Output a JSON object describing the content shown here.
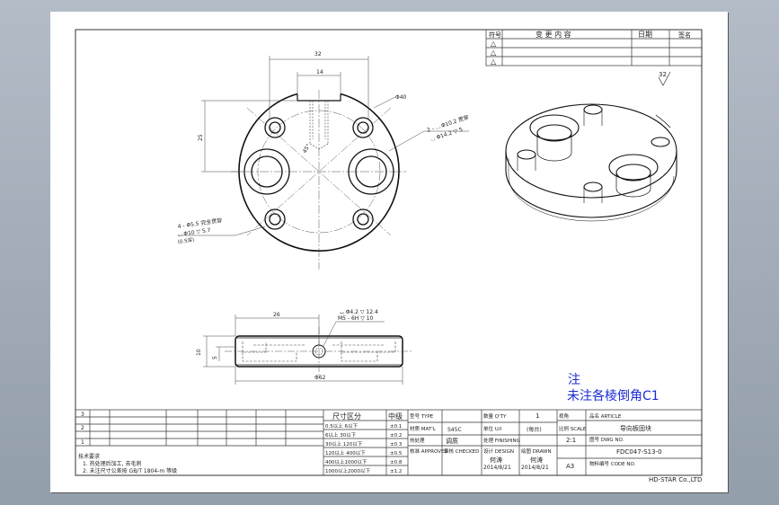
{
  "revision_table": {
    "headers": [
      "符号",
      "变 更 内 容",
      "日期",
      "签名"
    ],
    "rows": [
      "△",
      "△",
      "△"
    ]
  },
  "surface_symbol": "32",
  "dims": {
    "top_width": "32",
    "slot_width": "14",
    "outer_dia": "Φ40",
    "height_left": "25",
    "angle": "45°",
    "counterbore": [
      "2 - ⌴ Φ10.2 贯穿",
      "⌴ Φ14.2 ▽ 5"
    ],
    "small_holes": [
      "4 - Φ5.5 完全贯穿",
      "⌴ Φ10 ▽ 5.7",
      "(0.5深)"
    ],
    "thread": [
      "⌴ Φ4.2 ▽ 12.4",
      "M5 - 6H ▽ 10"
    ],
    "side_len": "26",
    "side_height": "10",
    "side_inner": "5",
    "side_dia": "Φ62"
  },
  "note": {
    "title": "注",
    "body": "未注各棱倒角C1"
  },
  "title_block": {
    "left_rows": [
      "3",
      "2",
      "1"
    ],
    "tech_title": "技术要求",
    "tech_lines": [
      "1. 热处理后加工, 去毛刺",
      "2. 未注尺寸公差按 GB/T 1804-m 等级"
    ],
    "size_header": "尺寸区分",
    "tol_header": "中级",
    "sizes": [
      "0.5以上 6以下",
      "6以上 30以下",
      "30以上 120以下",
      "120以上 400以下",
      "400以上1000以下",
      "1000以上2000以下"
    ],
    "tols": [
      "±0.1",
      "±0.2",
      "±0.3",
      "±0.5",
      "±0.8",
      "±1.2"
    ],
    "type_label": "型号 TYPE",
    "mat_label": "材质 MAT'L",
    "mat_value": "S45C",
    "heat_label": "热处理",
    "heat_value": "调质",
    "qty_label": "数量 Q'TY",
    "qty_value": "1",
    "unit_label": "单位 U/I",
    "unit_value": "(每台)",
    "finish_label": "处理 FINISHING",
    "approved_label": "核准 APPROVED",
    "checked_label": "审核 CHECKED",
    "design_label": "设计 DESIGN",
    "drawn_label": "绘图 DRAWN",
    "drafter": "何涛",
    "designer": "何涛",
    "date1": "2014/8/21",
    "date2": "2014/8/21",
    "proj_label": "视角",
    "scale_label": "比例 SCALE",
    "scale_value": "2:1",
    "size_value": "A3",
    "name_label": "品名 ARTICLE",
    "name_value": "导向板固块",
    "dwg_label": "图号 DWG NO.",
    "dwg_value": "FDC047-S13-0",
    "code_label": "物料编号 CODE NO.",
    "company": "HD-STAR Co.,LTD"
  }
}
